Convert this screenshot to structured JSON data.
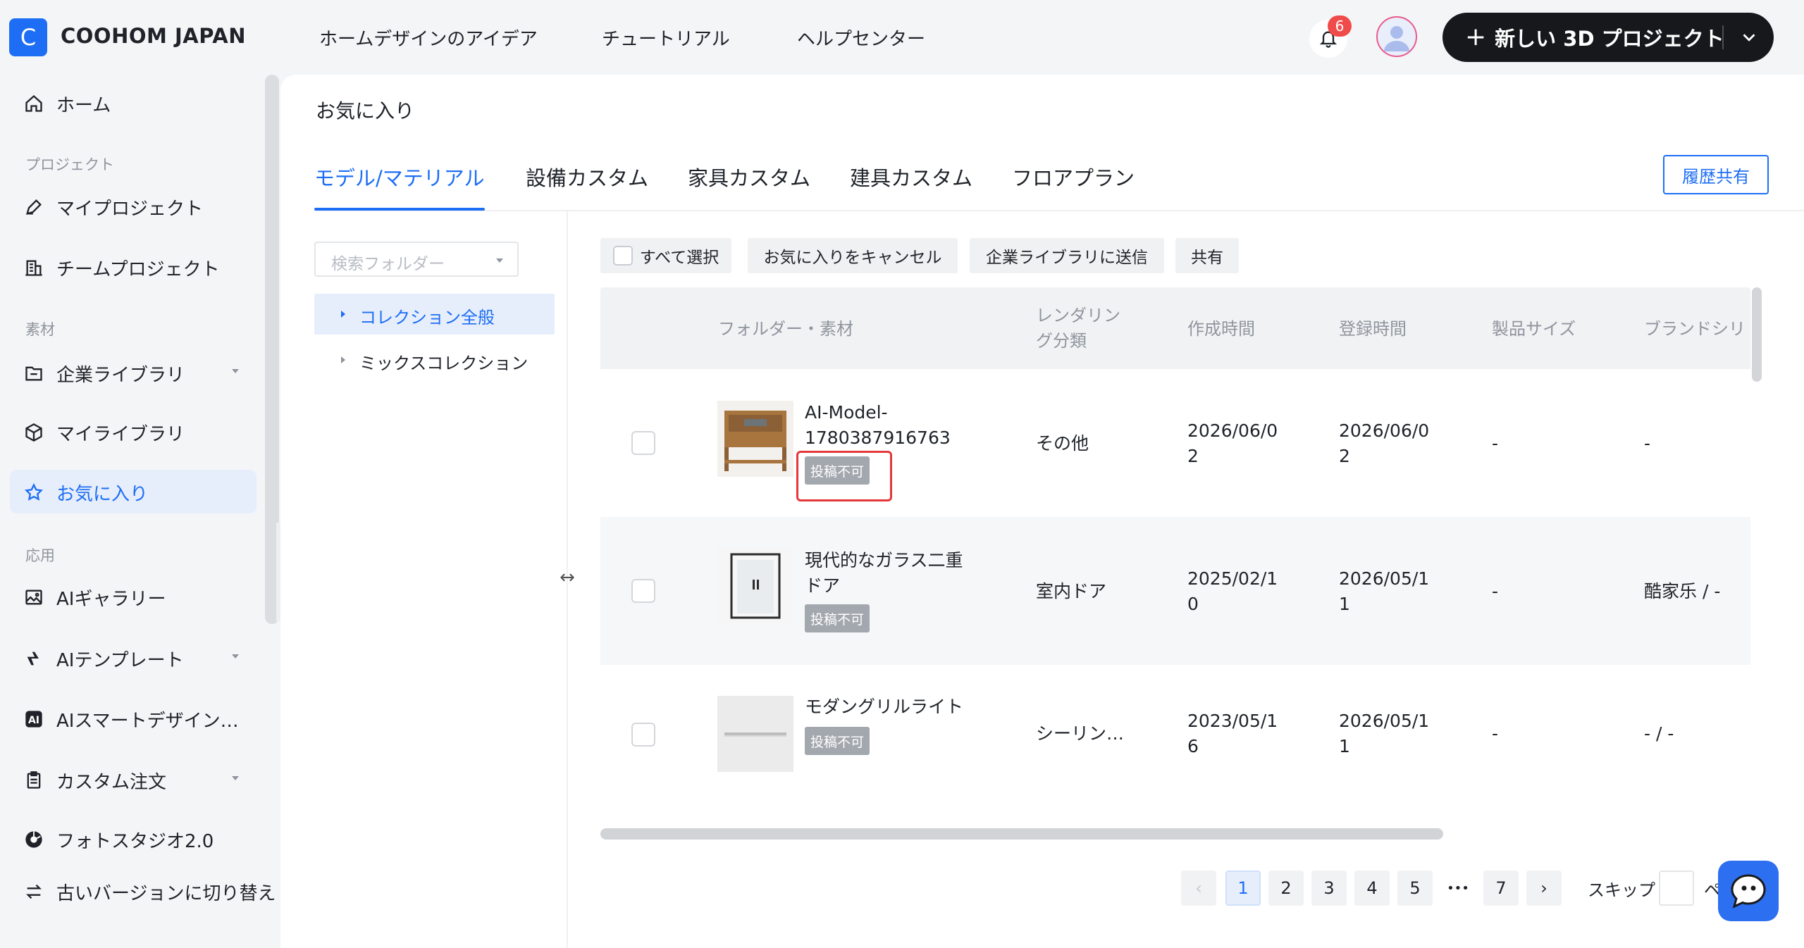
{
  "header": {
    "logo_letter": "C",
    "brand": "COOHOM JAPAN",
    "nav": [
      "ホームデザインのアイデア",
      "チュートリアル",
      "ヘルプセンター"
    ],
    "notification_count": "6",
    "new_project_plus": "+",
    "new_project_label": "新しい 3D プロジェクト"
  },
  "sidebar": {
    "home": "ホーム",
    "section_project": "プロジェクト",
    "my_projects": "マイプロジェクト",
    "team_projects": "チームプロジェクト",
    "section_material": "素材",
    "enterprise_library": "企業ライブラリ",
    "my_library": "マイライブラリ",
    "favorites": "お気に入り",
    "section_apps": "応用",
    "ai_gallery": "AIギャラリー",
    "ai_template": "AIテンプレート",
    "ai_smart_design": "AIスマートデザイン…",
    "custom_order": "カスタム注文",
    "photo_studio": "フォトスタジオ2.0",
    "old_version": "古いバージョンに切り替え"
  },
  "main": {
    "title": "お気に入り",
    "tabs": [
      "モデル/マテリアル",
      "設備カスタム",
      "家具カスタム",
      "建具カスタム",
      "フロアプラン"
    ],
    "share_history": "履歴共有",
    "folder_search_placeholder": "検索フォルダー",
    "folders": [
      "コレクション全般",
      "ミックスコレクション"
    ],
    "toolbar": {
      "select_all": "すべて選択",
      "cancel_favorite": "お気に入りをキャンセル",
      "send_to_library": "企業ライブラリに送信",
      "share": "共有"
    },
    "table": {
      "headers": {
        "folder_material": "フォルダー・素材",
        "render_class_1": "レンダリン",
        "render_class_2": "グ分類",
        "created": "作成時間",
        "registered": "登録時間",
        "size": "製品サイズ",
        "brand": "ブランドシリ"
      },
      "rows": [
        {
          "name_1": "AI-Model-",
          "name_2": "1780387916763",
          "tag": "投稿不可",
          "render_class": "その他",
          "created_1": "2026/06/0",
          "created_2": "2",
          "registered_1": "2026/06/0",
          "registered_2": "2",
          "size": "-",
          "brand": "-"
        },
        {
          "name_1": "現代的なガラス二重",
          "name_2": "ドア",
          "tag": "投稿不可",
          "render_class": "室内ドア",
          "created_1": "2025/02/1",
          "created_2": "0",
          "registered_1": "2026/05/1",
          "registered_2": "1",
          "size": "-",
          "brand": "酷家乐 / -"
        },
        {
          "name_1": "モダングリルライト",
          "name_2": "",
          "tag": "投稿不可",
          "render_class": "シーリン…",
          "created_1": "2023/05/1",
          "created_2": "6",
          "registered_1": "2026/05/1",
          "registered_2": "1",
          "size": "-",
          "brand": "- / -"
        }
      ]
    },
    "pagination": {
      "prev": "‹",
      "pages": [
        "1",
        "2",
        "3",
        "4",
        "5"
      ],
      "ellipsis": "•••",
      "last": "7",
      "next": "›",
      "skip_label": "スキップ",
      "tail": "ペ"
    }
  },
  "colors": {
    "accent": "#1e6ef5",
    "highlight": "#e5383b",
    "tag": "#a3a7ae"
  }
}
